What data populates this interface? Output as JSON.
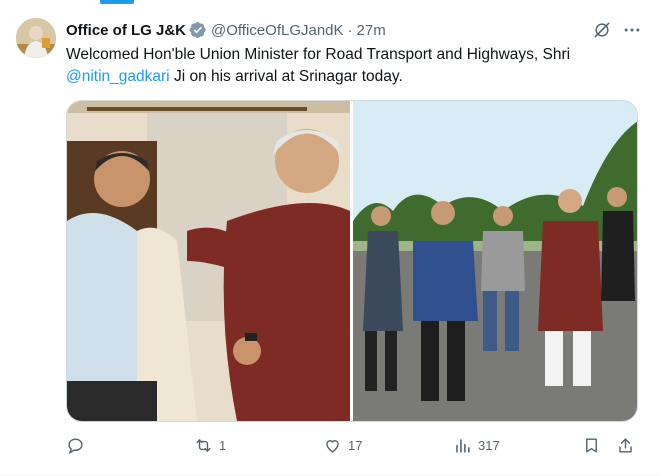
{
  "tweet": {
    "author_name": "Office of LG J&K",
    "author_handle": "@OfficeOfLGJandK",
    "separator": "·",
    "time": "27m",
    "text_before": "Welcomed Hon'ble Union Minister for Road Transport and Highways, Shri",
    "mention": "@nitin_gadkari",
    "text_after": " Ji on his arrival at Srinagar today."
  },
  "actions": {
    "reply_count": "",
    "retweet_count": "1",
    "like_count": "17",
    "views_count": "317"
  },
  "colors": {
    "accent": "#1d9bf0",
    "muted": "#536471",
    "verified_badge": "#829aab",
    "border": "#cfd9de"
  },
  "icons": [
    "verified-badge-icon",
    "grok-icon",
    "more-icon",
    "reply-icon",
    "retweet-icon",
    "like-icon",
    "views-icon",
    "bookmark-icon",
    "share-icon"
  ]
}
